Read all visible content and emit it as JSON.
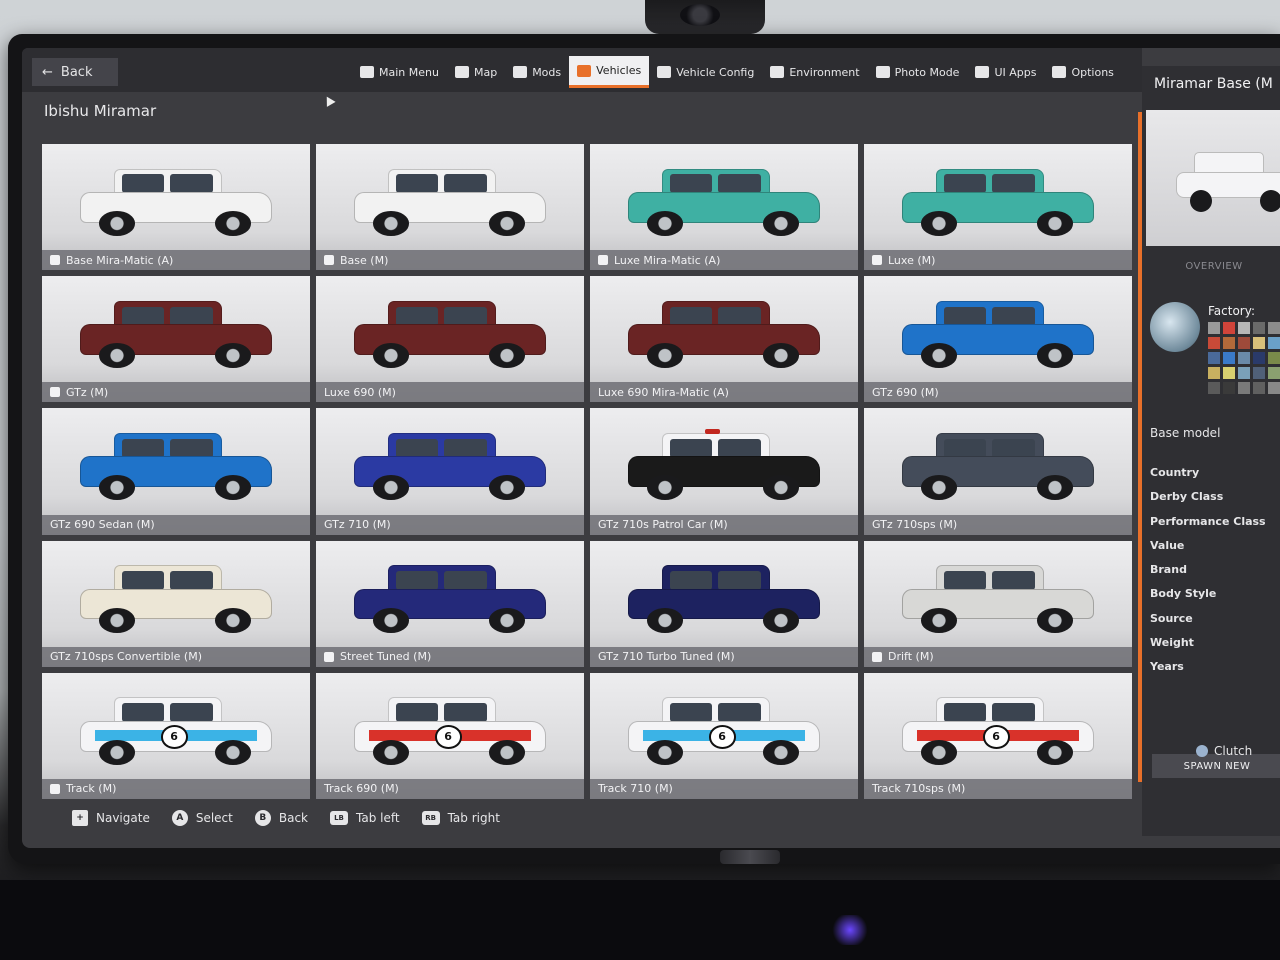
{
  "topbar": {
    "back_label": "Back",
    "tabs": [
      {
        "label": "Main Menu",
        "icon": "main-menu-icon",
        "active": false
      },
      {
        "label": "Map",
        "icon": "map-icon",
        "active": false
      },
      {
        "label": "Mods",
        "icon": "mods-icon",
        "active": false
      },
      {
        "label": "Vehicles",
        "icon": "vehicle-icon",
        "active": true
      },
      {
        "label": "Vehicle Config",
        "icon": "vehicle-config-icon",
        "active": false
      },
      {
        "label": "Environment",
        "icon": "environment-icon",
        "active": false
      },
      {
        "label": "Photo Mode",
        "icon": "camera-icon",
        "active": false
      },
      {
        "label": "UI Apps",
        "icon": "ui-apps-icon",
        "active": false
      },
      {
        "label": "Options",
        "icon": "options-icon",
        "active": false
      }
    ]
  },
  "page_title": "Ibishu Miramar",
  "vehicles": [
    {
      "label": "Base Mira-Matic (A)",
      "mod": true,
      "color": "#f2f2f2",
      "livery": "none"
    },
    {
      "label": "Base (M)",
      "mod": true,
      "color": "#f2f2f2",
      "livery": "none"
    },
    {
      "label": "Luxe Mira-Matic (A)",
      "mod": true,
      "color": "#3fb0a3",
      "livery": "none"
    },
    {
      "label": "Luxe (M)",
      "mod": true,
      "color": "#3fb0a3",
      "livery": "none"
    },
    {
      "label": "GTz (M)",
      "mod": true,
      "color": "#6a2424",
      "livery": "none"
    },
    {
      "label": "Luxe 690 (M)",
      "mod": false,
      "color": "#6a2424",
      "livery": "none"
    },
    {
      "label": "Luxe 690 Mira-Matic (A)",
      "mod": false,
      "color": "#6a2424",
      "livery": "none"
    },
    {
      "label": "GTz 690 (M)",
      "mod": false,
      "color": "#1f73c9",
      "livery": "none"
    },
    {
      "label": "GTz 690 Sedan (M)",
      "mod": false,
      "color": "#1f73c9",
      "livery": "none"
    },
    {
      "label": "GTz 710 (M)",
      "mod": false,
      "color": "#2b3aa3",
      "livery": "none"
    },
    {
      "label": "GTz 710s Patrol Car (M)",
      "mod": false,
      "color": "#1a1a1a",
      "livery": "police"
    },
    {
      "label": "GTz 710sps (M)",
      "mod": false,
      "color": "#444c5a",
      "livery": "none"
    },
    {
      "label": "GTz 710sps Convertible (M)",
      "mod": false,
      "color": "#ece6d6",
      "livery": "none"
    },
    {
      "label": "Street Tuned (M)",
      "mod": true,
      "color": "#24297a",
      "livery": "none"
    },
    {
      "label": "GTz 710 Turbo Tuned (M)",
      "mod": false,
      "color": "#1d2260",
      "livery": "none"
    },
    {
      "label": "Drift (M)",
      "mod": true,
      "color": "#d8d8d6",
      "livery": "none"
    },
    {
      "label": "Track (M)",
      "mod": true,
      "color": "#f4f4f6",
      "livery": "race-blue",
      "number": "6"
    },
    {
      "label": "Track 690 (M)",
      "mod": false,
      "color": "#f4f4f6",
      "livery": "race-red",
      "number": "6"
    },
    {
      "label": "Track 710 (M)",
      "mod": false,
      "color": "#f4f4f6",
      "livery": "race-blue",
      "number": "6"
    },
    {
      "label": "Track 710sps (M)",
      "mod": false,
      "color": "#f4f4f6",
      "livery": "race-red",
      "number": "6"
    }
  ],
  "panel": {
    "title": "Miramar Base (M",
    "overview_label": "OVERVIEW",
    "factory_label": "Factory:",
    "swatches": [
      "#9a9a9a",
      "#d0443a",
      "#b7b7b7",
      "#6a6a6a",
      "#8c8c8c",
      "#c84a38",
      "#b36a3a",
      "#9e4a3a",
      "#d8c07a",
      "#6aa0c8",
      "#4a6a9a",
      "#3a7ac8",
      "#6a8aa8",
      "#2a3a6a",
      "#7a8a4a",
      "#c8b060",
      "#d8d070",
      "#7aa0b8",
      "#506078",
      "#8aa070",
      "#5a5a5a",
      "#3a3a3a",
      "#7a7a7a",
      "#606060",
      "#888888"
    ],
    "base_model": "Base model",
    "attributes": [
      "Country",
      "Derby Class",
      "Performance Class",
      "Value",
      "Brand",
      "Body Style",
      "Source",
      "Weight",
      "Years"
    ],
    "spawn_label": "SPAWN NEW",
    "clutch_label": "Clutch"
  },
  "hints": [
    {
      "glyph": "+",
      "label": "Navigate",
      "kind": "dpad"
    },
    {
      "glyph": "A",
      "label": "Select",
      "kind": "round"
    },
    {
      "glyph": "B",
      "label": "Back",
      "kind": "round"
    },
    {
      "glyph": "LB",
      "label": "Tab left",
      "kind": "sq"
    },
    {
      "glyph": "RB",
      "label": "Tab right",
      "kind": "sq"
    }
  ]
}
